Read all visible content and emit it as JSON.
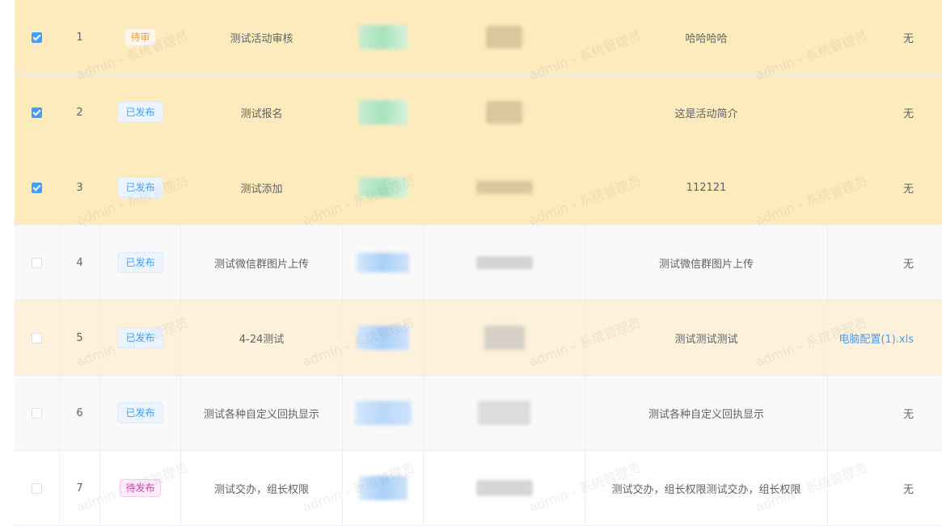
{
  "watermark": "admin - 系统管理员",
  "rows": [
    {
      "index": "1",
      "checked": true,
      "status": "待审",
      "status_style": "yellow",
      "name": "测试活动审核",
      "desc": "哈哈哈哈",
      "attachment": "无",
      "attachment_is_link": false,
      "style": "selected"
    },
    {
      "index": "2",
      "checked": true,
      "status": "已发布",
      "status_style": "blue",
      "name": "测试报名",
      "desc": "这是活动简介",
      "attachment": "无",
      "attachment_is_link": false,
      "style": "selected"
    },
    {
      "index": "3",
      "checked": true,
      "status": "已发布",
      "status_style": "blue",
      "name": "测试添加",
      "desc": "112121",
      "attachment": "无",
      "attachment_is_link": false,
      "style": "selected"
    },
    {
      "index": "4",
      "checked": false,
      "status": "已发布",
      "status_style": "blue",
      "name": "测试微信群图片上传",
      "desc": "测试微信群图片上传",
      "attachment": "无",
      "attachment_is_link": false,
      "style": "plain"
    },
    {
      "index": "5",
      "checked": false,
      "status": "已发布",
      "status_style": "blue",
      "name": "4-24测试",
      "desc": "测试测试测试",
      "attachment": "电脑配置(1).xls",
      "attachment_is_link": true,
      "style": "hover"
    },
    {
      "index": "6",
      "checked": false,
      "status": "已发布",
      "status_style": "blue",
      "name": "测试各种自定义回执显示",
      "desc": "测试各种自定义回执显示",
      "attachment": "无",
      "attachment_is_link": false,
      "style": "plain"
    },
    {
      "index": "7",
      "checked": false,
      "status": "待发布",
      "status_style": "pink",
      "name": "测试交办，组长权限",
      "desc": "测试交办，组长权限测试交办，组长权限",
      "attachment": "无",
      "attachment_is_link": false,
      "style": "last"
    }
  ],
  "colors": {
    "selected_row": "#fdebbd",
    "hover_row": "#fdf1dc",
    "accent": "#409eff"
  }
}
